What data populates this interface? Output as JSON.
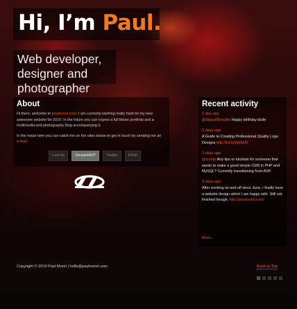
{
  "hero": {
    "title_prefix": "Hi, I’m ",
    "title_accent": "Paul.",
    "tagline": "Web developer, designer and photographer"
  },
  "about": {
    "heading": "About",
    "p1_start": "Hi there, welcome to ",
    "p1_link": "paulmorel.com",
    "p1_end": ". I am currently working really hard on my new awesome website for 2010. In the future you can expect a full blown portfolio and a multimedia and photography blog accompanying it.",
    "p2_start": "In the mean time you can catch me on the sites below or get in touch by sending me an ",
    "p2_link": "e-mail",
    "p2_end": ".",
    "buttons": [
      "Last.fm",
      "DeviantART",
      "Twitter",
      "Flickr"
    ],
    "active_button": "DeviantART"
  },
  "activity": {
    "heading": "Recent activity",
    "items": [
      {
        "date": "1 day ago",
        "link": "@SignalNoiseArt",
        "text": " Happy birthday dude"
      },
      {
        "date": "2 days ago",
        "link": "",
        "text": "A Guide to Creating Professional Quality Logo Designs ",
        "link2": "http://bit.ly/aWSoI2"
      },
      {
        "date": "3 days ago",
        "link": "@tcorde",
        "text": " Any tips or tutorials for someone that wants to make a good simple CMS in PHP and MySQL? Currently transitioning from ASP."
      },
      {
        "date": "3 days ago",
        "link": "",
        "text": "After working on and off since June, I finally have a website design which I am happy with. Still not finished though. ",
        "link2": "http://paulmorel.com/"
      }
    ],
    "more": "More..."
  },
  "footer": {
    "copyright": "Copyright © 2010 Paul Morel | hello@paulmorel.com",
    "back_to_top": "Back to Top"
  },
  "colors": {
    "accent": "#e8581c",
    "title_accent": "#f07a22"
  }
}
